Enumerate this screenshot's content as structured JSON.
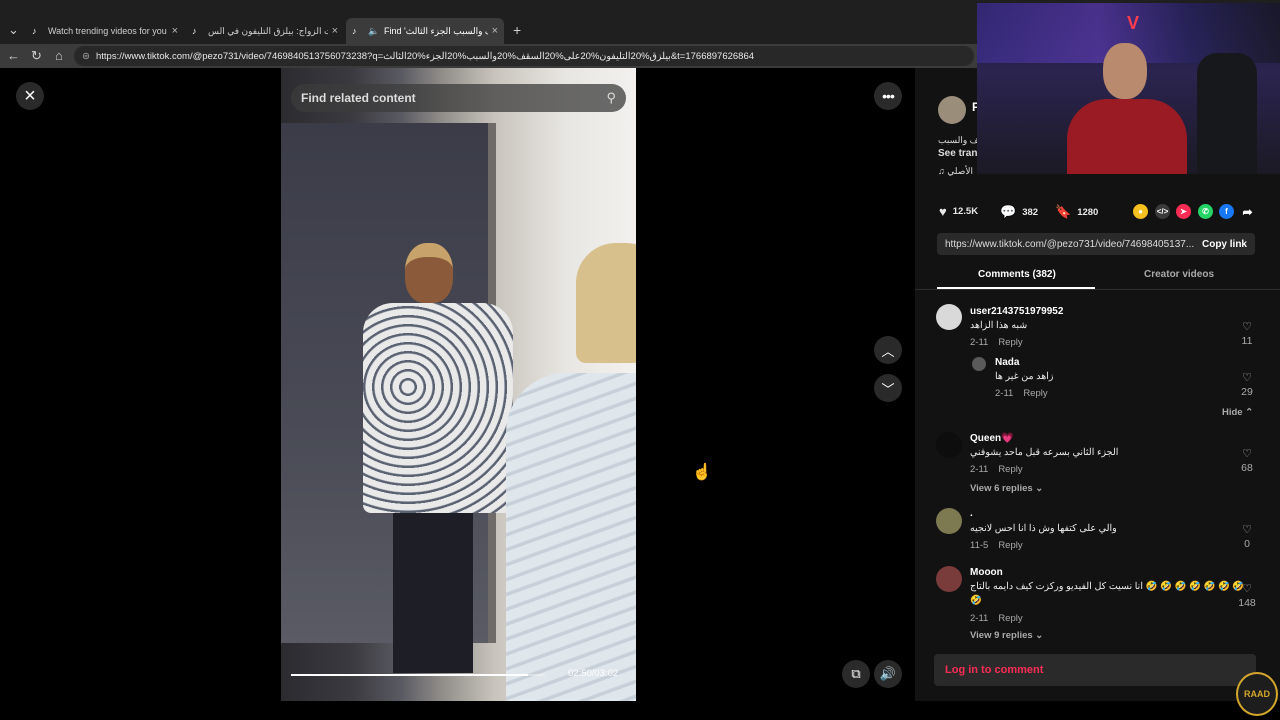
{
  "browser": {
    "tabs": [
      {
        "label": "Watch trending videos for you | Tik",
        "active": false
      },
      {
        "label": "مفاجآت الزواج: بيلزق التليفون في الس",
        "active": false
      },
      {
        "label": "Find 'سقف والسبب الجزء الثالث'",
        "active": true
      }
    ],
    "new_tab": "+",
    "url": "https://www.tiktok.com/@pezo731/video/7469840513756073238?q=بيلزق%20التليفون%20على%20السقف%20والسبب%20الجزء%20الثالث&t=1766897626864"
  },
  "video": {
    "search_placeholder": "Find related content",
    "time": "02:50/03:02",
    "progress": 0.934
  },
  "author": {
    "name": "P",
    "desc": "قف والسبب",
    "see_translation": "See tran",
    "music": "♫  الأصلي"
  },
  "stats": {
    "likes": "12.5K",
    "comments": "382",
    "saves": "1280"
  },
  "link": {
    "url": "https://www.tiktok.com/@pezo731/video/74698405137...",
    "copy": "Copy link"
  },
  "tabs": {
    "comments": "Comments (382)",
    "creator": "Creator videos"
  },
  "comments": [
    {
      "user": "user2143751979952",
      "text": "شبه هذا الزاهد",
      "date": "2-11",
      "reply": "Reply",
      "likes": "11"
    },
    {
      "user": "Nada",
      "text": "زاهد من غير ها",
      "date": "2-11",
      "reply": "Reply",
      "likes": "29",
      "is_reply": true
    },
    {
      "user": "Queen💗",
      "text": "الجزء الثاني بسرعه قبل ماحد يشوفني",
      "date": "2-11",
      "reply": "Reply",
      "likes": "68"
    },
    {
      "user": ".",
      "text": "والي على كتفها وش ذا انا احس لانجيه",
      "date": "11-5",
      "reply": "Reply",
      "likes": "0"
    },
    {
      "user": "Mooon",
      "text": "انا نسيت كل الفيديو وركزت كيف دايمه بالتاج 🤣 🤣 🤣 🤣 🤣 🤣 🤣",
      "text2": "🤣",
      "date": "2-11",
      "reply": "Reply",
      "likes": "148"
    }
  ],
  "hide_label": "Hide ⌃",
  "view_replies": [
    "View 6 replies ⌄",
    "View 9 replies ⌄"
  ],
  "login": "Log in to comment",
  "overlay": {
    "badge": "RAAD"
  }
}
